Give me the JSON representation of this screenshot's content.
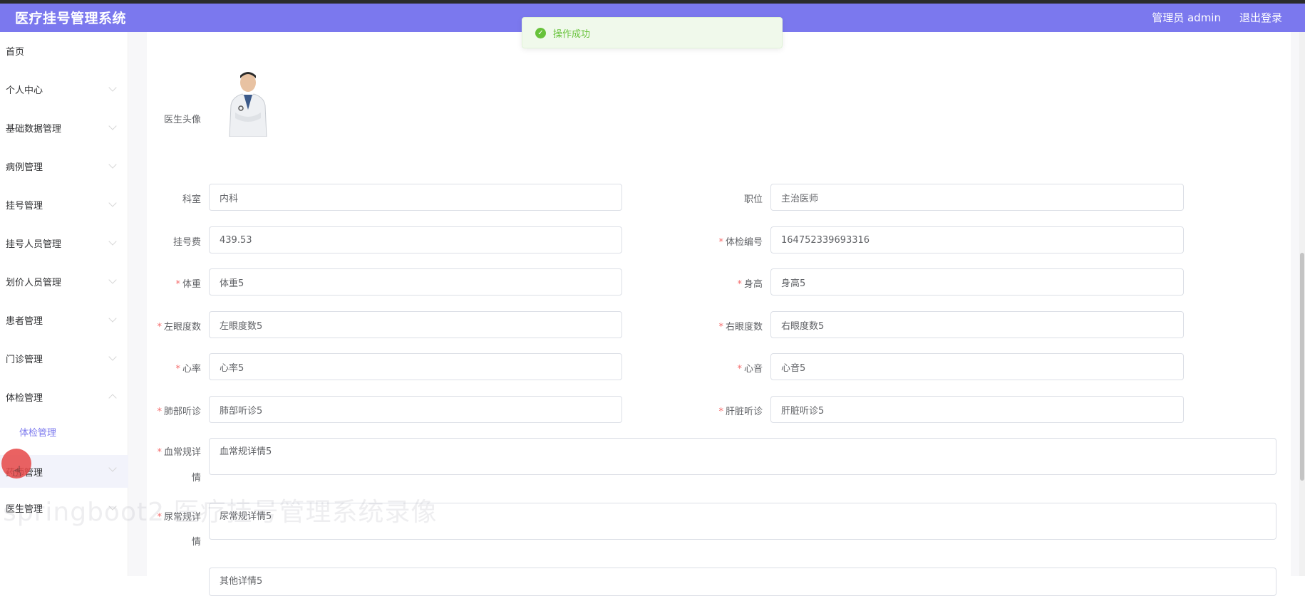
{
  "header": {
    "title": "医疗挂号管理系统",
    "user": "管理员 admin",
    "logout": "退出登录"
  },
  "toast": {
    "message": "操作成功"
  },
  "sidebar": {
    "items": [
      {
        "label": "首页"
      },
      {
        "label": "个人中心"
      },
      {
        "label": "基础数据管理"
      },
      {
        "label": "病例管理"
      },
      {
        "label": "挂号管理"
      },
      {
        "label": "挂号人员管理"
      },
      {
        "label": "划价人员管理"
      },
      {
        "label": "患者管理"
      },
      {
        "label": "门诊管理"
      },
      {
        "label": "体检管理"
      },
      {
        "label": "体检管理"
      },
      {
        "label": "药师管理"
      },
      {
        "label": "医生管理"
      }
    ]
  },
  "form": {
    "avatar_label": "医生头像",
    "department": {
      "label": "科室",
      "value": "内科"
    },
    "position": {
      "label": "职位",
      "value": "主治医师"
    },
    "fee": {
      "label": "挂号费",
      "value": "439.53"
    },
    "exam_no": {
      "label": "体检编号",
      "value": "164752339693316"
    },
    "weight": {
      "label": "体重",
      "value": "体重5"
    },
    "height": {
      "label": "身高",
      "value": "身高5"
    },
    "left_eye": {
      "label": "左眼度数",
      "value": "左眼度数5"
    },
    "right_eye": {
      "label": "右眼度数",
      "value": "右眼度数5"
    },
    "heart_rate": {
      "label": "心率",
      "value": "心率5"
    },
    "heart_sound": {
      "label": "心音",
      "value": "心音5"
    },
    "lung": {
      "label": "肺部听诊",
      "value": "肺部听诊5"
    },
    "liver": {
      "label": "肝脏听诊",
      "value": "肝脏听诊5"
    },
    "blood": {
      "label_line1": "血常规详",
      "label_line2": "情",
      "value": "血常规详情5"
    },
    "urine": {
      "label_line1": "尿常规详",
      "label_line2": "情",
      "value": "尿常规详情5"
    },
    "other": {
      "value": "其他详情5"
    }
  },
  "watermark": "springboot2 医疗挂号管理系统录像",
  "colors": {
    "header": "#7b78ee",
    "success": "#67c23a",
    "required": "#f56c6c"
  }
}
